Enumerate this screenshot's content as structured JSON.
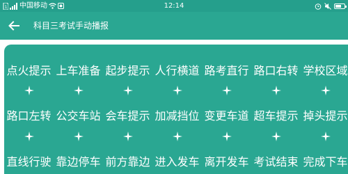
{
  "status_bar": {
    "carrier": "中国移动",
    "time": "12:14",
    "battery_level": 0.7
  },
  "app_bar": {
    "back_icon": "arrow-left-icon",
    "title": "科目三考试手动播报"
  },
  "buttons": [
    [
      {
        "id": "ignition-tip",
        "label": "点火提示"
      },
      {
        "id": "get-in-prepare",
        "label": "上车准备"
      },
      {
        "id": "start-tip",
        "label": "起步提示"
      },
      {
        "id": "crosswalk",
        "label": "人行横道"
      },
      {
        "id": "road-straight",
        "label": "路考直行"
      },
      {
        "id": "intersection-right",
        "label": "路口右转"
      },
      {
        "id": "school-zone",
        "label": "学校区域"
      }
    ],
    [
      {
        "id": "intersection-left",
        "label": "路口左转"
      },
      {
        "id": "bus-stop",
        "label": "公交车站"
      },
      {
        "id": "meet-car-tip",
        "label": "会车提示"
      },
      {
        "id": "gear-shift",
        "label": "加减挡位"
      },
      {
        "id": "lane-change",
        "label": "变更车道"
      },
      {
        "id": "overtake-tip",
        "label": "超车提示"
      },
      {
        "id": "u-turn-tip",
        "label": "掉头提示"
      }
    ],
    [
      {
        "id": "straight-drive",
        "label": "直线行驶"
      },
      {
        "id": "pull-over",
        "label": "靠边停车"
      },
      {
        "id": "ahead-pull-over",
        "label": "前方靠边"
      },
      {
        "id": "enter-depart",
        "label": "进入发车"
      },
      {
        "id": "leave-depart",
        "label": "离开发车"
      },
      {
        "id": "exam-end",
        "label": "考试结束"
      },
      {
        "id": "finish-get-off",
        "label": "完成下车"
      }
    ]
  ],
  "colors": {
    "status_bar": "#259f8c",
    "primary": "#2aa792",
    "text": "#ffffff"
  }
}
